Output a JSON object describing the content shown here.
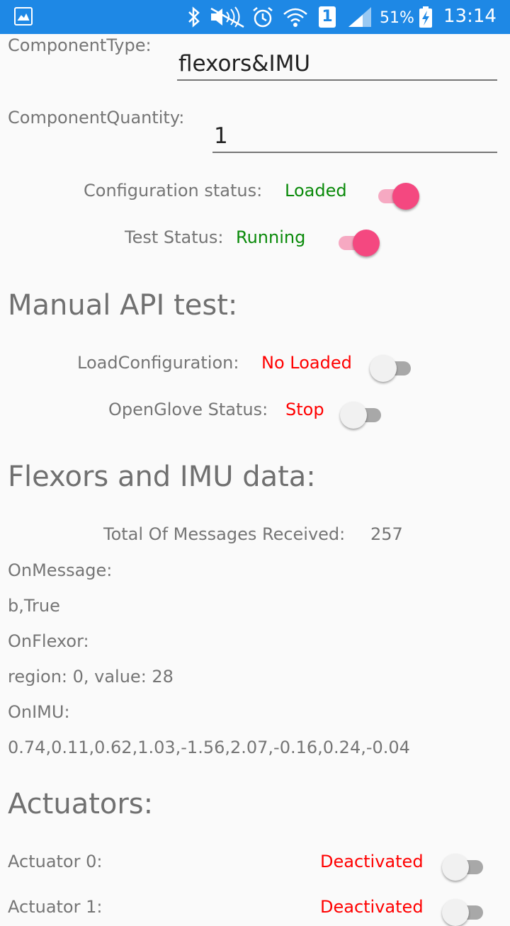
{
  "status_bar": {
    "sim_slot": "1",
    "battery": "51%",
    "time": "13:14"
  },
  "config": {
    "component_type_label": "ComponentType:",
    "component_type_value": "flexors&IMU",
    "component_quantity_label": "ComponentQuantity:",
    "component_quantity_value": "1",
    "configuration_status_label": "Configuration status:",
    "configuration_status_value": "Loaded",
    "test_status_label": "Test Status:",
    "test_status_value": "Running"
  },
  "manual": {
    "heading": "Manual API test:",
    "load_configuration_label": "LoadConfiguration:",
    "load_configuration_value": "No Loaded",
    "openglove_status_label": "OpenGlove Status:",
    "openglove_status_value": "Stop"
  },
  "flexors": {
    "heading": "Flexors and IMU data:",
    "total_label": "Total Of Messages Received:",
    "total_value": "257",
    "on_message_label": "OnMessage:",
    "on_message_value": "b,True",
    "on_flexor_label": "OnFlexor:",
    "on_flexor_value": "region: 0, value: 28",
    "on_imu_label": "OnIMU:",
    "on_imu_value": "0.74,0.11,0.62,1.03,-1.56,2.07,-0.16,0.24,-0.04"
  },
  "actuators": {
    "heading": "Actuators:",
    "items": [
      {
        "label": "Actuator 0:",
        "status": "Deactivated"
      },
      {
        "label": "Actuator 1:",
        "status": "Deactivated"
      }
    ]
  },
  "colors": {
    "status_bar": "#1e88e5",
    "switch_on": "#f44880",
    "ok_text": "#0a8a0a",
    "error_text": "#ff0000"
  }
}
